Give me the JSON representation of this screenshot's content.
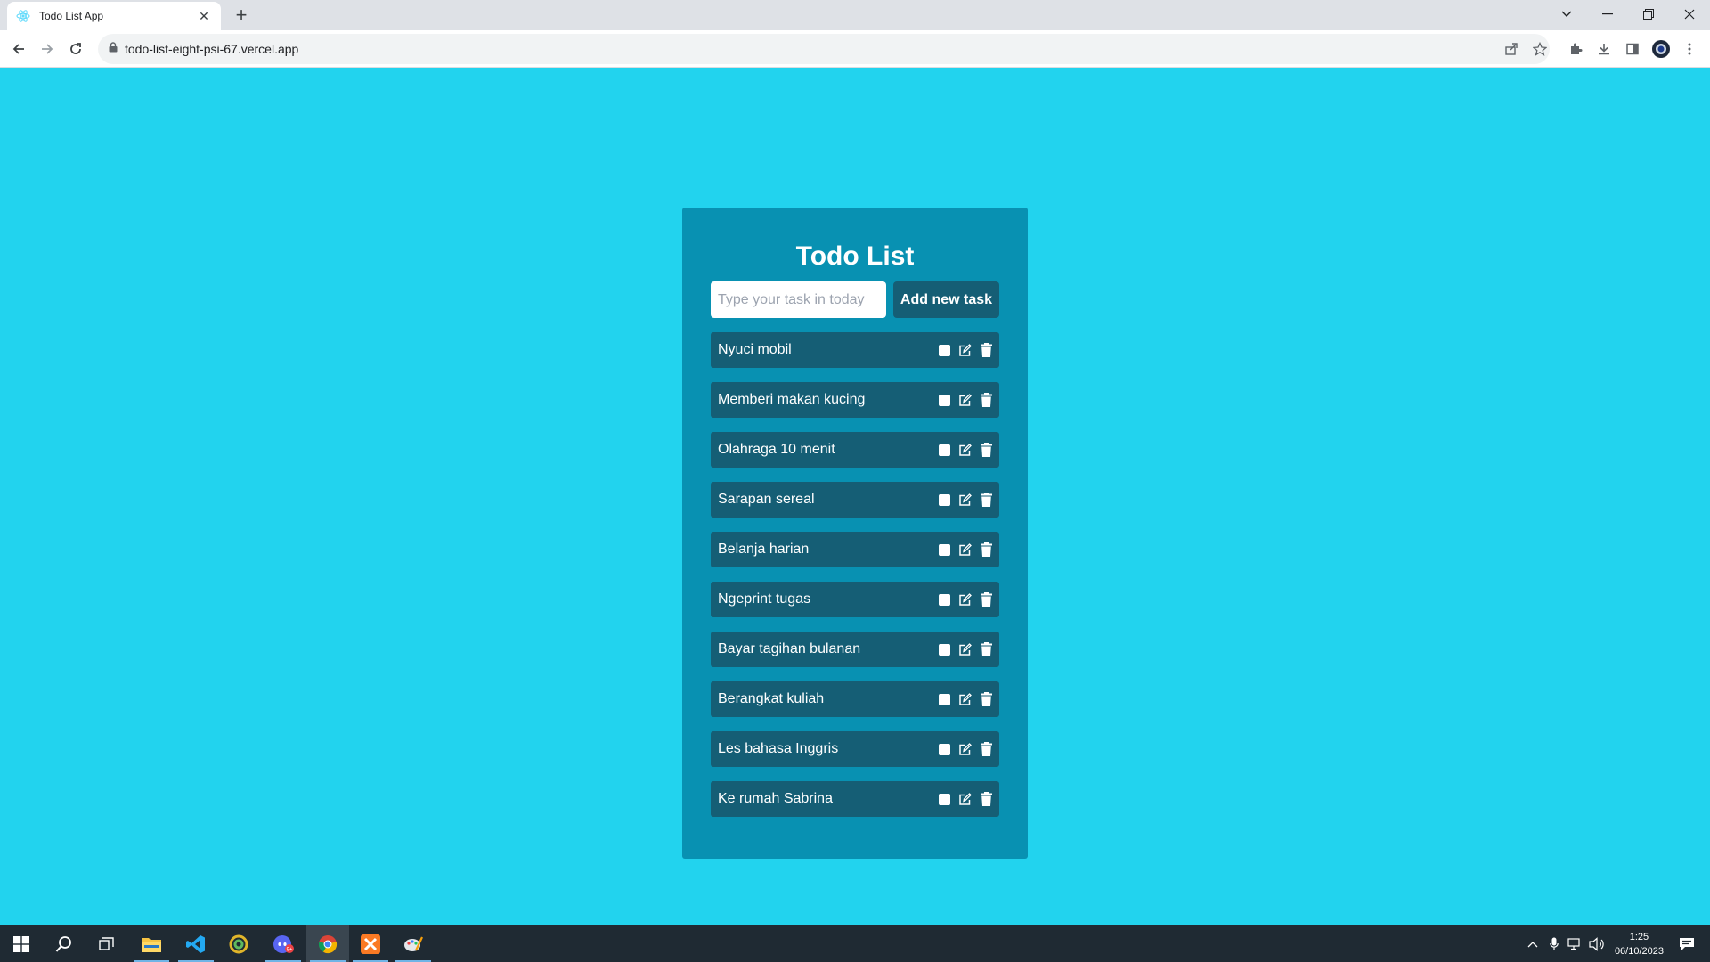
{
  "browser": {
    "tab_title": "Todo List App",
    "url": "todo-list-eight-psi-67.vercel.app"
  },
  "app": {
    "title": "Todo List",
    "input_placeholder": "Type your task in today",
    "add_button_label": "Add new task",
    "todos": [
      {
        "text": "Nyuci mobil",
        "done": false
      },
      {
        "text": "Memberi makan kucing",
        "done": false
      },
      {
        "text": "Olahraga 10 menit",
        "done": false
      },
      {
        "text": "Sarapan sereal",
        "done": false
      },
      {
        "text": "Belanja harian",
        "done": false
      },
      {
        "text": "Ngeprint tugas",
        "done": false
      },
      {
        "text": "Bayar tagihan bulanan",
        "done": false
      },
      {
        "text": "Berangkat kuliah",
        "done": false
      },
      {
        "text": "Les bahasa Inggris",
        "done": false
      },
      {
        "text": "Ke rumah Sabrina",
        "done": false
      }
    ]
  },
  "taskbar": {
    "time": "1:25",
    "date": "06/10/2023"
  },
  "colors": {
    "page_bg": "#22d3ee",
    "card_bg": "#0891b2",
    "item_bg": "#155e75"
  }
}
